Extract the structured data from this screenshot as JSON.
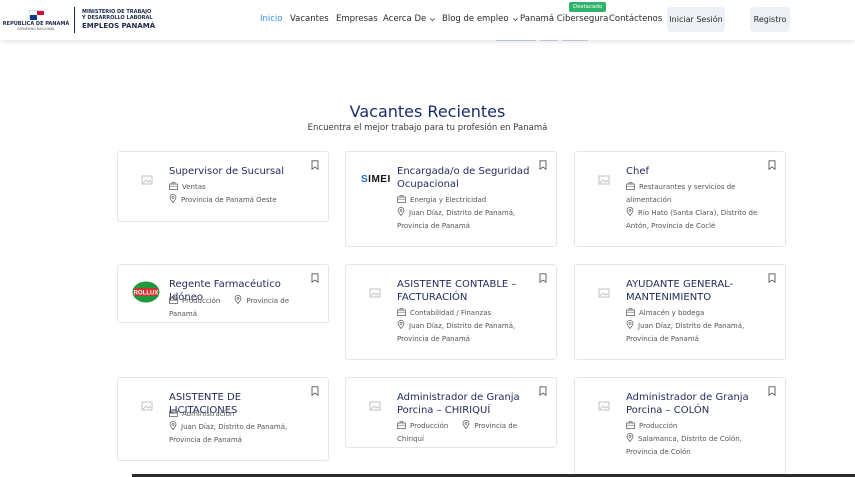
{
  "header": {
    "logo": {
      "country": "REPÚBLICA DE PANAMÁ",
      "gov": "GOBIERNO NACIONAL",
      "ministry_line1": "MINISTERIO DE TRABAJO",
      "ministry_line2": "Y DESARROLLO LABORAL",
      "brand": "EMPLEOS PANAMÁ"
    },
    "nav": [
      {
        "label": "Inicio",
        "active": true
      },
      {
        "label": "Vacantes"
      },
      {
        "label": "Empresas"
      },
      {
        "label": "Acerca De",
        "dropdown": true
      },
      {
        "label": "Blog de empleo",
        "dropdown": true
      },
      {
        "label": "Panamá Cibersegura"
      },
      {
        "label": "Contáctenos"
      }
    ],
    "badge": "Destacado",
    "login": "Iniciar Sesión",
    "register": "Registro"
  },
  "colors": {
    "accent": "#3a8de6",
    "title": "#1a2c6b",
    "badge": "#2fb36b"
  },
  "section": {
    "title": "Vacantes Recientes",
    "subtitle": "Encuentra el mejor trabajo para tu profesión en Panamá"
  },
  "jobs": [
    {
      "title": "Supervisor de Sucursal",
      "category": "Ventas",
      "location": "Provincia de Panamá Oeste",
      "logo": "placeholder-icon"
    },
    {
      "title": "Encargada/o de Seguridad Ocupacional",
      "category": "Energía y Electricidad",
      "location": "Juan Díaz, Distrito de Panamá, Provincia de Panamá",
      "logo": "SIMEI"
    },
    {
      "title": "Chef",
      "category": "Restaurantes y servicios de alimentación",
      "location": "Río Hato (Santa Clara), Distrito de Antón, Provincia de Coclé",
      "logo": "placeholder-icon"
    },
    {
      "title": "Regente Farmacéutico Idóneo",
      "category": "Producción",
      "location": "Provincia de Panamá",
      "logo": "ROLLUX"
    },
    {
      "title": "ASISTENTE CONTABLE – FACTURACIÓN",
      "category": "Contabilidad / Finanzas",
      "location": "Juan Díaz, Distrito de Panamá, Provincia de Panamá",
      "logo": "placeholder-icon"
    },
    {
      "title": "AYUDANTE GENERAL- MANTENIMIENTO",
      "category": "Almacén y bodega",
      "location": "Juan Díaz, Distrito de Panamá, Provincia de Panamá",
      "logo": "placeholder-icon"
    },
    {
      "title": "ASISTENTE DE LICITACIONES",
      "category": "Administración",
      "location": "Juan Díaz, Distrito de Panamá, Provincia de Panamá",
      "logo": "placeholder-icon"
    },
    {
      "title": "Administrador de Granja Porcina – CHIRIQUÍ",
      "category": "Producción",
      "location": "Provincia de Chiriquí",
      "logo": "placeholder-icon"
    },
    {
      "title": "Administrador de Granja Porcina – COLÓN",
      "category": "Producción",
      "location": "Salamanca, Distrito de Colón, Provincia de Colón",
      "logo": "placeholder-icon"
    }
  ]
}
